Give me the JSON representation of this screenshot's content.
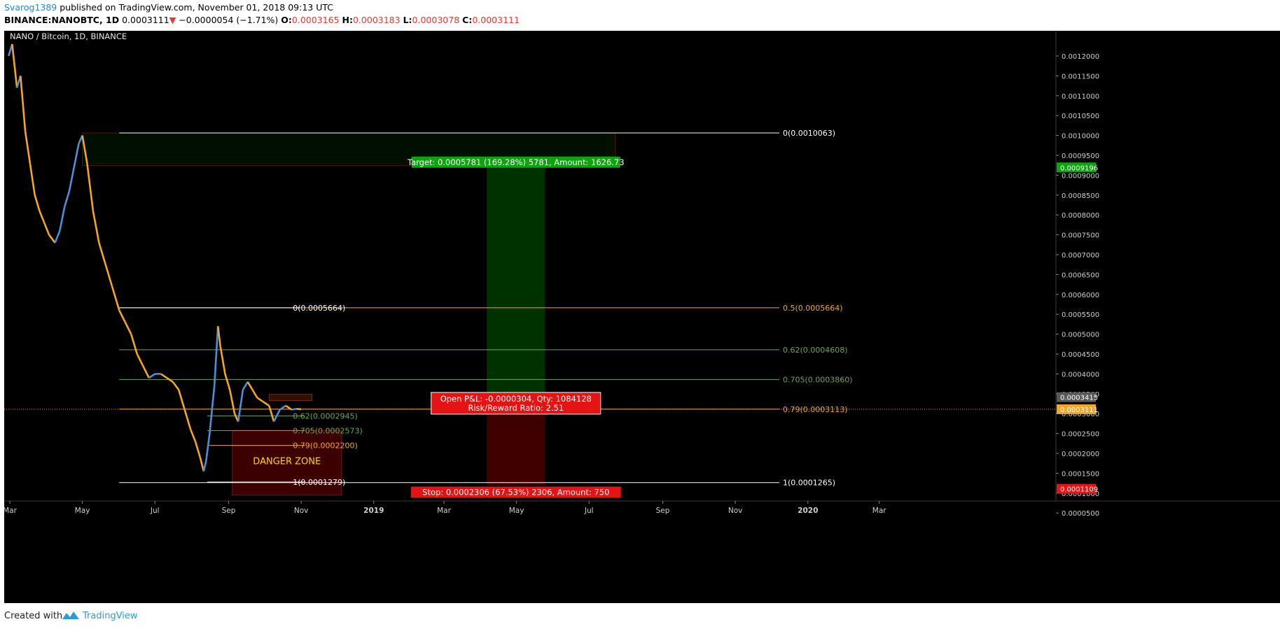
{
  "header": {
    "user": "Svarog1389",
    "published": "published on TradingView.com, November 01, 2018 09:13 UTC",
    "symbol": "BINANCE:NANOBTC, 1D",
    "last": "0.0003111",
    "arrow": "▼",
    "change": "−0.0000054 (−1.71%)",
    "o_label": "O:",
    "o_val": "0.0003165",
    "h_label": "H:",
    "h_val": "0.0003183",
    "l_label": "L:",
    "l_val": "0.0003078",
    "c_label": "C:",
    "c_val": "0.0003111"
  },
  "footer": {
    "created_with": "Created with",
    "brand": "TradingView"
  },
  "colors": {
    "background": "#000000",
    "candle_up": "#4a90d9",
    "candle_down": "#f5a623",
    "grid": "#1a1a1a",
    "fib_white": "#ffffff",
    "fib_orange": "#f5a623",
    "fib_green": "#6aa84f",
    "target_green": "#0da50d",
    "stop_red": "#e41414",
    "danger_text": "#ffd600"
  },
  "chart_data": {
    "type": "candlestick",
    "title": "NANO / Bitcoin, 1D, BINANCE",
    "x_ticks": [
      "Mar",
      "May",
      "Jul",
      "Sep",
      "Nov",
      "2019",
      "Mar",
      "May",
      "Jul",
      "Sep",
      "Nov",
      "2020",
      "Mar"
    ],
    "x_ticks_bold": [
      "2019",
      "2020"
    ],
    "y_ticks": [
      "0.0012000",
      "0.0011500",
      "0.0011000",
      "0.0010500",
      "0.0010000",
      "0.0009500",
      "0.0009000",
      "0.0008500",
      "0.0008000",
      "0.0007500",
      "0.0007000",
      "0.0006500",
      "0.0006000",
      "0.0005500",
      "0.0005000",
      "0.0004500",
      "0.0004000",
      "0.0003500",
      "0.0003000",
      "0.0002500",
      "0.0002000",
      "0.0001500",
      "0.0001000",
      "0.0000500"
    ],
    "ylim": [
      4e-05,
      0.00124
    ],
    "price_path": [
      {
        "date": "2018-02-28",
        "price": 0.0012
      },
      {
        "date": "2018-03-03",
        "price": 0.00123
      },
      {
        "date": "2018-03-07",
        "price": 0.00112
      },
      {
        "date": "2018-03-10",
        "price": 0.00115
      },
      {
        "date": "2018-03-14",
        "price": 0.00101
      },
      {
        "date": "2018-03-18",
        "price": 0.00093
      },
      {
        "date": "2018-03-22",
        "price": 0.00085
      },
      {
        "date": "2018-03-26",
        "price": 0.00081
      },
      {
        "date": "2018-03-30",
        "price": 0.00078
      },
      {
        "date": "2018-04-03",
        "price": 0.00075
      },
      {
        "date": "2018-04-08",
        "price": 0.00073
      },
      {
        "date": "2018-04-12",
        "price": 0.00076
      },
      {
        "date": "2018-04-16",
        "price": 0.00082
      },
      {
        "date": "2018-04-20",
        "price": 0.00086
      },
      {
        "date": "2018-04-24",
        "price": 0.00092
      },
      {
        "date": "2018-04-28",
        "price": 0.00098
      },
      {
        "date": "2018-05-01",
        "price": 0.001
      },
      {
        "date": "2018-05-05",
        "price": 0.00093
      },
      {
        "date": "2018-05-10",
        "price": 0.00081
      },
      {
        "date": "2018-05-15",
        "price": 0.00073
      },
      {
        "date": "2018-05-20",
        "price": 0.00068
      },
      {
        "date": "2018-05-26",
        "price": 0.00062
      },
      {
        "date": "2018-06-01",
        "price": 0.00056
      },
      {
        "date": "2018-06-06",
        "price": 0.00053
      },
      {
        "date": "2018-06-11",
        "price": 0.0005
      },
      {
        "date": "2018-06-16",
        "price": 0.00045
      },
      {
        "date": "2018-06-21",
        "price": 0.00042
      },
      {
        "date": "2018-06-26",
        "price": 0.00039
      },
      {
        "date": "2018-07-01",
        "price": 0.0004
      },
      {
        "date": "2018-07-06",
        "price": 0.0004
      },
      {
        "date": "2018-07-11",
        "price": 0.00039
      },
      {
        "date": "2018-07-16",
        "price": 0.00038
      },
      {
        "date": "2018-07-21",
        "price": 0.00036
      },
      {
        "date": "2018-07-26",
        "price": 0.00031
      },
      {
        "date": "2018-07-31",
        "price": 0.00026
      },
      {
        "date": "2018-08-04",
        "price": 0.00023
      },
      {
        "date": "2018-08-08",
        "price": 0.00019
      },
      {
        "date": "2018-08-11",
        "price": 0.000155
      },
      {
        "date": "2018-08-13",
        "price": 0.00018
      },
      {
        "date": "2018-08-16",
        "price": 0.00025
      },
      {
        "date": "2018-08-20",
        "price": 0.00037
      },
      {
        "date": "2018-08-23",
        "price": 0.00052
      },
      {
        "date": "2018-08-25",
        "price": 0.00047
      },
      {
        "date": "2018-08-29",
        "price": 0.0004
      },
      {
        "date": "2018-09-02",
        "price": 0.00036
      },
      {
        "date": "2018-09-06",
        "price": 0.0003
      },
      {
        "date": "2018-09-09",
        "price": 0.00028
      },
      {
        "date": "2018-09-13",
        "price": 0.00036
      },
      {
        "date": "2018-09-17",
        "price": 0.00038
      },
      {
        "date": "2018-09-21",
        "price": 0.00036
      },
      {
        "date": "2018-09-25",
        "price": 0.00034
      },
      {
        "date": "2018-09-30",
        "price": 0.00033
      },
      {
        "date": "2018-10-05",
        "price": 0.00032
      },
      {
        "date": "2018-10-09",
        "price": 0.00028
      },
      {
        "date": "2018-10-14",
        "price": 0.00031
      },
      {
        "date": "2018-10-19",
        "price": 0.00032
      },
      {
        "date": "2018-10-24",
        "price": 0.00031
      },
      {
        "date": "2018-10-28",
        "price": 0.000312
      },
      {
        "date": "2018-11-01",
        "price": 0.0003111
      }
    ],
    "fib_levels": [
      {
        "label": "0(0.0010063)",
        "price": 0.0010063,
        "start": "2018-06-01",
        "end": "2019-12-08",
        "color": "#ffffff"
      },
      {
        "label": "0.5(0.0005664)",
        "price": 0.0005664,
        "start": "2018-06-01",
        "end": "2019-12-08",
        "color": "#f5a623"
      },
      {
        "label": "0.62(0.0004608)",
        "price": 0.0004608,
        "start": "2018-06-01",
        "end": "2019-12-08",
        "color": "#6aa84f"
      },
      {
        "label": "0.705(0.0003860)",
        "price": 0.000386,
        "start": "2018-06-01",
        "end": "2019-12-08",
        "color": "#6aa84f"
      },
      {
        "label": "0.79(0.0003113)",
        "price": 0.0003113,
        "start": "2018-06-01",
        "end": "2019-12-08",
        "color": "#f5a623"
      },
      {
        "label": "1(0.0001265)",
        "price": 0.0001265,
        "start": "2018-06-01",
        "end": "2019-12-08",
        "color": "#ffffff"
      }
    ],
    "fib2_levels": [
      {
        "label": "0(0.0005664)",
        "price": 0.0005664,
        "start": "2018-06-01",
        "end": "2018-10-31",
        "color": "#ffffff"
      },
      {
        "label": "0.62(0.0002945)",
        "price": 0.0002945,
        "start": "2018-08-14",
        "end": "2018-11-04",
        "color": "#6aa84f"
      },
      {
        "label": "0.705(0.0002573)",
        "price": 0.0002573,
        "start": "2018-08-14",
        "end": "2018-11-04",
        "color": "#6aa84f"
      },
      {
        "label": "0.79(0.0002200)",
        "price": 0.00022,
        "start": "2018-08-14",
        "end": "2018-11-04",
        "color": "#f5a623"
      },
      {
        "label": "1(0.0001279)",
        "price": 0.0001279,
        "start": "2018-08-14",
        "end": "2018-11-04",
        "color": "#ffffff"
      }
    ],
    "danger_zone": {
      "label": "DANGER ZONE",
      "start": "2018-09-04",
      "end": "2018-12-05",
      "top": 0.000258,
      "bottom": 9.5e-05
    },
    "supply_zone": {
      "start": "2018-05-01",
      "end": "2019-07-23",
      "top": 0.0010063,
      "bottom": 0.000924
    },
    "position": {
      "start": "2019-04-06",
      "end": "2019-05-25",
      "entry": 0.0003111,
      "target": 0.000924,
      "stop": 0.00012,
      "target_label": "Target: 0.0005781 (169.28%) 5781, Amount: 1626.73",
      "pnl_label": "Open P&L: -0.0000304, Qty: 1084128",
      "rr_label": "Risk/Reward Ratio: 2.51",
      "stop_label": "Stop: 0.0002306 (67.53%) 2306, Amount: 750"
    },
    "price_tags": [
      {
        "text": "0.0009196",
        "price": 0.0009196,
        "bg": "#0da50d"
      },
      {
        "text": "0.0003415",
        "price": 0.0003415,
        "bg": "#595959"
      },
      {
        "text": "0.0003111",
        "price": 0.0003111,
        "bg": "#f5a623"
      },
      {
        "text": "0.0001109",
        "price": 0.0001109,
        "bg": "#e41414"
      }
    ],
    "last_price_line": 0.0003111
  }
}
